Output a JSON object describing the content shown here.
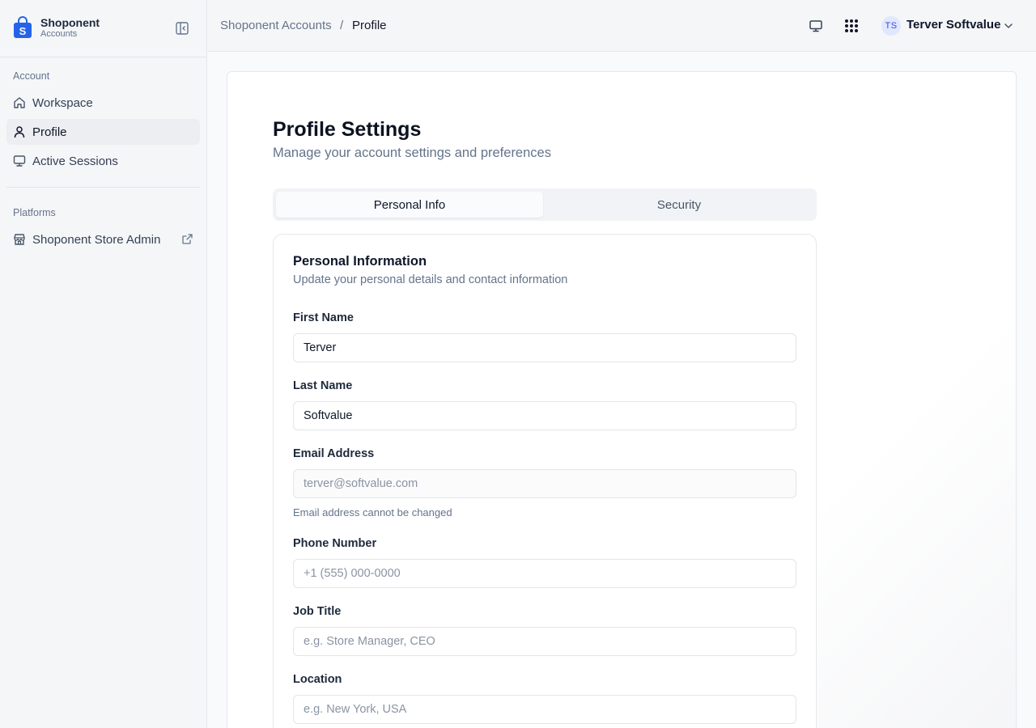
{
  "brand": {
    "name": "Shoponent",
    "subtitle": "Accounts",
    "logo_icon": "shopping-bag-logo",
    "accent": "#2563eb"
  },
  "sidebar": {
    "sections": [
      {
        "label": "Account"
      },
      {
        "label": "Platforms"
      }
    ],
    "account_items": [
      {
        "label": "Workspace",
        "icon": "home-icon",
        "active": false
      },
      {
        "label": "Profile",
        "icon": "user-icon",
        "active": true
      },
      {
        "label": "Active Sessions",
        "icon": "monitor-icon",
        "active": false
      }
    ],
    "platform_items": [
      {
        "label": "Shoponent Store Admin",
        "icon": "store-icon",
        "external": true
      }
    ]
  },
  "header": {
    "breadcrumb": {
      "root": "Shoponent Accounts",
      "separator": "/",
      "current": "Profile"
    },
    "user": {
      "initials": "TS",
      "name": "Terver Softvalue"
    }
  },
  "main": {
    "title": "Profile Settings",
    "subtitle": "Manage your account settings and preferences",
    "tabs": [
      {
        "label": "Personal Info",
        "active": true
      },
      {
        "label": "Security",
        "active": false
      }
    ],
    "card": {
      "title": "Personal Information",
      "subtitle": "Update your personal details and contact information",
      "fields": {
        "first_name": {
          "label": "First Name",
          "value": "Terver",
          "placeholder": ""
        },
        "last_name": {
          "label": "Last Name",
          "value": "Softvalue",
          "placeholder": ""
        },
        "email": {
          "label": "Email Address",
          "value": "terver@softvalue.com",
          "help": "Email address cannot be changed"
        },
        "phone": {
          "label": "Phone Number",
          "value": "",
          "placeholder": "+1 (555) 000-0000"
        },
        "job_title": {
          "label": "Job Title",
          "value": "",
          "placeholder": "e.g. Store Manager, CEO"
        },
        "location": {
          "label": "Location",
          "value": "",
          "placeholder": "e.g. New York, USA"
        }
      }
    }
  }
}
